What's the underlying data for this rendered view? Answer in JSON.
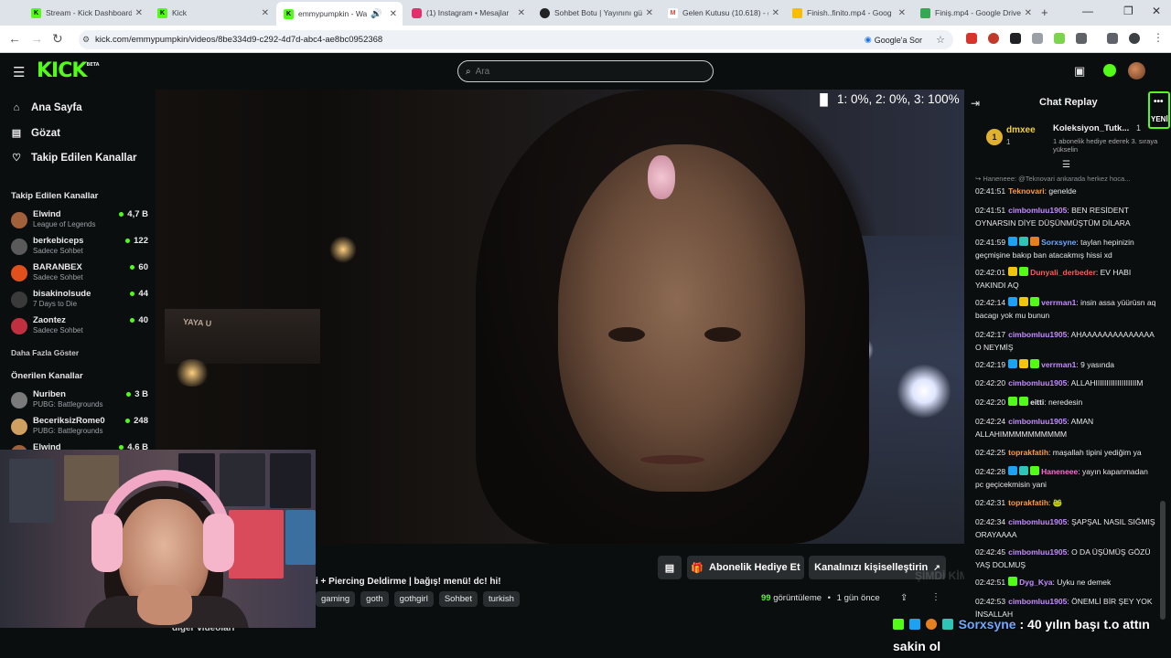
{
  "browser": {
    "tabs": [
      {
        "label": "Stream - Kick Dashboard",
        "fav": "K",
        "color": "#53fc18"
      },
      {
        "label": "Kick",
        "fav": "K",
        "color": "#53fc18"
      },
      {
        "label": "emmypumpkin - Wat",
        "fav": "K",
        "color": "#53fc18"
      },
      {
        "label": "(1) Instagram • Mesajlar",
        "fav": "",
        "color": "#e1306c"
      },
      {
        "label": "Sohbet Botu | Yayınını gü",
        "fav": "",
        "color": "#222222"
      },
      {
        "label": "Gelen Kutusu (10.618) - g",
        "fav": "M",
        "color": "#ea4335"
      },
      {
        "label": "Finish..finito.mp4 - Goog",
        "fav": "",
        "color": "#fbbc04"
      },
      {
        "label": "Finiş.mp4 - Google Drive",
        "fav": "",
        "color": "#34a853"
      }
    ],
    "url": "kick.com/emmypumpkin/videos/8be334d9-c292-4d7d-abc4-ae8bc0952368",
    "ask_google": "Google'a Sor"
  },
  "header": {
    "logo": "KICK",
    "beta": "BETA",
    "search_placeholder": "Ara"
  },
  "sidebar": {
    "nav": [
      {
        "label": "Ana Sayfa",
        "icon": "home-icon"
      },
      {
        "label": "Gözat",
        "icon": "browse-icon"
      },
      {
        "label": "Takip Edilen Kanallar",
        "icon": "heart-icon"
      }
    ],
    "followed_title": "Takip Edilen Kanallar",
    "followed": [
      {
        "name": "Elwind",
        "category": "League of Legends",
        "viewers": "4,7 B",
        "color": "#a0603a"
      },
      {
        "name": "berkebiceps",
        "category": "Sadece Sohbet",
        "viewers": "122",
        "color": "#5a5a5a"
      },
      {
        "name": "BARANBEX",
        "category": "Sadece Sohbet",
        "viewers": "60",
        "color": "#e0501c"
      },
      {
        "name": "bisakinolsude",
        "category": "7 Days to Die",
        "viewers": "44",
        "color": "#3a3a3a"
      },
      {
        "name": "Zaontez",
        "category": "Sadece Sohbet",
        "viewers": "40",
        "color": "#c03040"
      }
    ],
    "show_more": "Daha Fazla Göster",
    "recommended_title": "Önerilen Kanallar",
    "recommended": [
      {
        "name": "Nuriben",
        "category": "PUBG: Battlegrounds",
        "viewers": "3 B",
        "color": "#7a7a7a"
      },
      {
        "name": "BeceriksizRome0",
        "category": "PUBG: Battlegrounds",
        "viewers": "248",
        "color": "#d0a060"
      },
      {
        "name": "Elwind",
        "category": "",
        "viewers": "4,6 B",
        "color": "#a0603a"
      }
    ]
  },
  "video": {
    "quality": "1: 0%, 2: 0%, 3: 100%",
    "sign_text": "YAYA U",
    "title_fragment": "i + Piercing Deldirme | bağış! menü! dc! hi!",
    "tags": [
      "gaming",
      "goth",
      "gothgirl",
      "Sohbet",
      "turkish"
    ],
    "views_count": "99",
    "views_label": "görüntüleme",
    "separator": "•",
    "uploaded": "1 gün önce",
    "gift_sub_btn": "Abonelik Hediye Et",
    "customize_btn": "Kanalınızı kişiselleştirin",
    "more_videos": "diğer videoları"
  },
  "chat": {
    "title": "Chat Replay",
    "new_badge": "YENİ",
    "pinned": {
      "rank": "1",
      "name": "dmxee",
      "value": "1",
      "title": "Koleksiyon_Tutk...",
      "count": "1",
      "desc": "1 abonelik hediye ederek 3. sıraya yükselin"
    },
    "reply_hint": "Haneneee: @Teknovari ankarada herkez hoca...",
    "messages": [
      {
        "ts": "02:41:51",
        "user": "Teknovari",
        "color": "#ff9a3c",
        "badges": [],
        "text": "genelde"
      },
      {
        "ts": "02:41:51",
        "user": "cimbomluu1905",
        "color": "#c58cff",
        "badges": [],
        "text": "BEN RESİDENT OYNARSIN DİYE DÜŞÜNMÜŞTÜM DİLARA"
      },
      {
        "ts": "02:41:59",
        "user": "Sorxsyne",
        "color": "#6fa8ff",
        "badges": [
          "#1da1f2",
          "#2ec4b6",
          "#e67e22"
        ],
        "text": "taylan hepinizin geçmişine bakıp ban atacakmış hissi xd"
      },
      {
        "ts": "02:42:01",
        "user": "Dunyali_derbeder",
        "color": "#ff5a5a",
        "badges": [
          "#f1c40f",
          "#53fc18"
        ],
        "text": "EV HABI YAKINDI AQ"
      },
      {
        "ts": "02:42:14",
        "user": "verrman1",
        "color": "#c58cff",
        "badges": [
          "#1da1f2",
          "#f1c40f",
          "#53fc18"
        ],
        "text": "insin assa yüürüsn aq bacagı yok mu bunun"
      },
      {
        "ts": "02:42:17",
        "user": "cimbomluu1905",
        "color": "#c58cff",
        "badges": [],
        "text": "AHAAAAAAAAAAAAAA O NEYMİŞ"
      },
      {
        "ts": "02:42:19",
        "user": "verrman1",
        "color": "#c58cff",
        "badges": [
          "#1da1f2",
          "#f1c40f",
          "#53fc18"
        ],
        "text": "9 yasında"
      },
      {
        "ts": "02:42:20",
        "user": "cimbomluu1905",
        "color": "#c58cff",
        "badges": [],
        "text": "ALLAHIIIIIIIIIIIIIIIIIIIM"
      },
      {
        "ts": "02:42:20",
        "user": "eitti",
        "color": "#e8e8e8",
        "badges": [
          "#53fc18",
          "#53fc18"
        ],
        "text": "neredesin"
      },
      {
        "ts": "02:42:24",
        "user": "cimbomluu1905",
        "color": "#c58cff",
        "badges": [],
        "text": "AMAN ALLAHIMMMMMMMMMM"
      },
      {
        "ts": "02:42:25",
        "user": "toprakfatih",
        "color": "#ff9a3c",
        "badges": [],
        "text": "maşallah tipini yediğim ya"
      },
      {
        "ts": "02:42:28",
        "user": "Haneneee",
        "color": "#ff6bd6",
        "badges": [
          "#1da1f2",
          "#2ec4b6",
          "#53fc18"
        ],
        "text": "yayın kapanmadan pc geçicekmisin yani"
      },
      {
        "ts": "02:42:31",
        "user": "toprakfatih",
        "color": "#ff9a3c",
        "badges": [],
        "text": "🐸"
      },
      {
        "ts": "02:42:34",
        "user": "cimbomluu1905",
        "color": "#c58cff",
        "badges": [],
        "text": "ŞAPŞAL NASIL SIĞMIŞ ORAYAAAA"
      },
      {
        "ts": "02:42:45",
        "user": "cimbomluu1905",
        "color": "#c58cff",
        "badges": [],
        "text": "O DA ÜŞÜMÜŞ GÖZÜ YAŞ DOLMUŞ"
      },
      {
        "ts": "02:42:51",
        "user": "Dyg_Kya",
        "color": "#c58cff",
        "badges": [
          "#53fc18"
        ],
        "text": "Uyku ne demek"
      },
      {
        "ts": "02:42:53",
        "user": "cimbomluu1905",
        "color": "#c58cff",
        "badges": [],
        "text": "ÖNEMLİ BİR ŞEY YOK İNSALLAH"
      }
    ]
  },
  "overlay": {
    "ghost": "ŞİMDİ KİM ALDI BU",
    "caption_user": "Sorxsyne",
    "caption_text": " : 40 yılın başı t.o attın sakin ol"
  }
}
